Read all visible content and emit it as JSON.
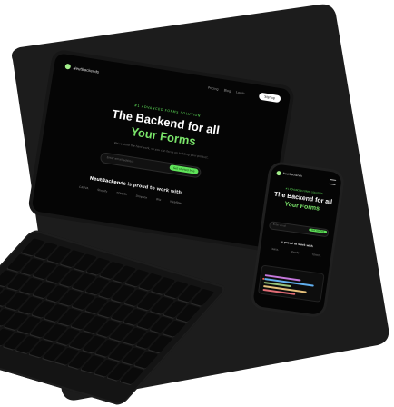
{
  "laptop": {
    "nav": {
      "brand": "NeutBackends",
      "links": [
        "Pricing",
        "Blog",
        "Login"
      ],
      "cta": "Signup"
    },
    "hero": {
      "eyebrow": "#1 ADVANCED FORMS SOLUTION",
      "title_line1": "The Backend for all",
      "title_line2": "Your Forms",
      "subtitle": "We've done the hard work, so you can focus on building your product.",
      "email_placeholder": "Enter email address",
      "email_button": "Get started free"
    },
    "proud": {
      "brand": "NeutBackends",
      "text": "is proud to work with"
    },
    "partners": [
      "CANVA",
      "Shopify",
      "TOYOTA",
      "Dropbox",
      "Wix",
      "Webflow"
    ]
  },
  "phone": {
    "brand": "NeutBackends",
    "eyebrow": "#1 ADVANCED FORMS SOLUTION",
    "title_line1": "The Backend for all",
    "title_line2": "Your Forms",
    "email_placeholder": "Enter email",
    "email_button": "Get started",
    "proud": "is proud to work with",
    "partners": [
      "CANVA",
      "Shopify",
      "TOYOTA"
    ]
  },
  "colors": {
    "accent": "#5fe35a",
    "accent_light": "#7ae46a",
    "background": "#1a1a1a"
  }
}
